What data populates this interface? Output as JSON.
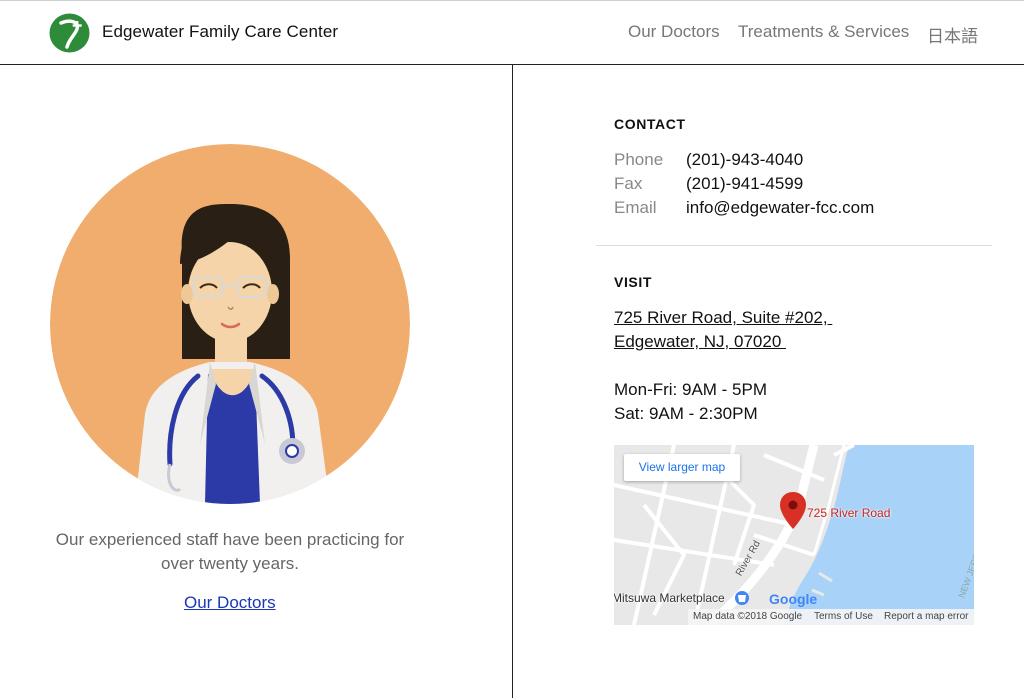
{
  "header": {
    "brand": "Edgewater Family Care Center",
    "nav": {
      "doctors": "Our Doctors",
      "treatments": "Treatments & Services",
      "language": "日本語"
    }
  },
  "left": {
    "tagline_line1": "Our experienced staff have been practicing for",
    "tagline_line2": "over twenty years.",
    "link": "Our Doctors"
  },
  "contact": {
    "title": "CONTACT",
    "phone_label": "Phone",
    "phone_value": "(201)-943-4040",
    "fax_label": "Fax",
    "fax_value": "(201)-941-4599",
    "email_label": "Email",
    "email_value": "info@edgewater-fcc.com"
  },
  "visit": {
    "title": "VISIT",
    "address_line1": "725 River Road, Suite #202, ",
    "address_line2": "Edgewater, NJ, 07020 ",
    "hours_line1": "Mon-Fri: 9AM - 5PM",
    "hours_line2": "Sat: 9AM - 2:30PM"
  },
  "map": {
    "larger_map": "View larger map",
    "pin_label": "725 River Road",
    "street_river": "River Rd",
    "poi": "Mitsuwa Marketplace",
    "logo": "Google",
    "map_data": "Map data ©2018 Google",
    "terms": "Terms of Use",
    "report": "Report a map error",
    "state_label": "NEW JERSEY",
    "colors": {
      "water": "#a8d2f7",
      "land": "#e8e8e8",
      "road": "#ffffff",
      "pin": "#d93025"
    }
  },
  "colors": {
    "brand_green": "#2e8b3a",
    "portrait_bg": "#f0ad6e",
    "link": "#1a38b5"
  }
}
